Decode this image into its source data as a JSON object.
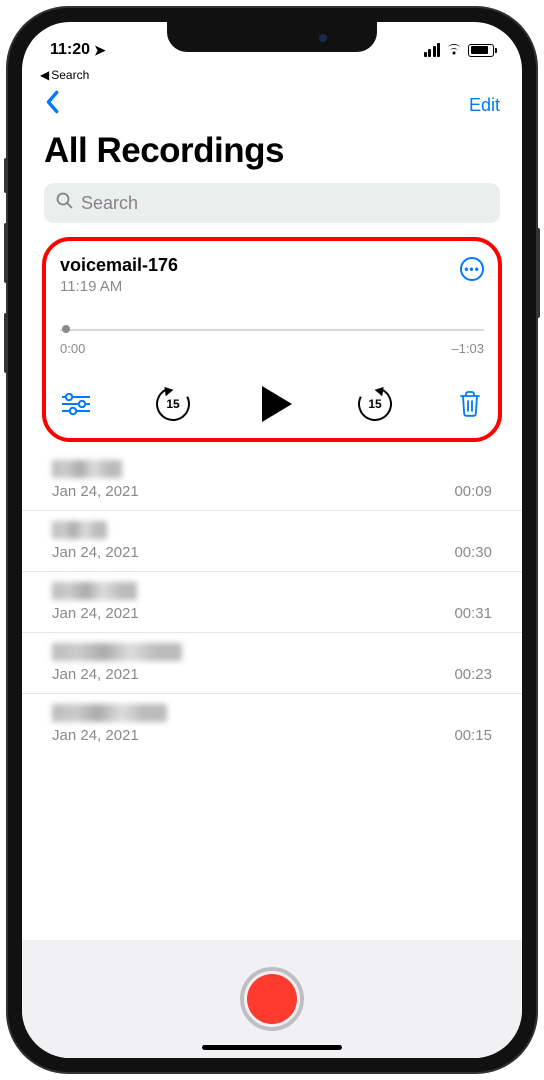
{
  "status": {
    "time": "11:20",
    "back_crumb": "Search"
  },
  "nav": {
    "edit": "Edit"
  },
  "title": "All Recordings",
  "search": {
    "placeholder": "Search"
  },
  "expanded": {
    "title": "voicemail-176",
    "subtitle": "11:19 AM",
    "elapsed": "0:00",
    "remaining": "–1:03",
    "skip_seconds": "15"
  },
  "list": [
    {
      "date": "Jan 24, 2021",
      "duration": "00:09",
      "blur_w": "w60"
    },
    {
      "date": "Jan 24, 2021",
      "duration": "00:30",
      "blur_w": "w50"
    },
    {
      "date": "Jan 24, 2021",
      "duration": "00:31",
      "blur_w": "w80"
    },
    {
      "date": "Jan 24, 2021",
      "duration": "00:23",
      "blur_w": "w120"
    },
    {
      "date": "Jan 24, 2021",
      "duration": "00:15",
      "blur_w": "w110"
    }
  ],
  "colors": {
    "accent": "#007aff",
    "record": "#ff3b30",
    "highlight_border": "#ff0000"
  }
}
